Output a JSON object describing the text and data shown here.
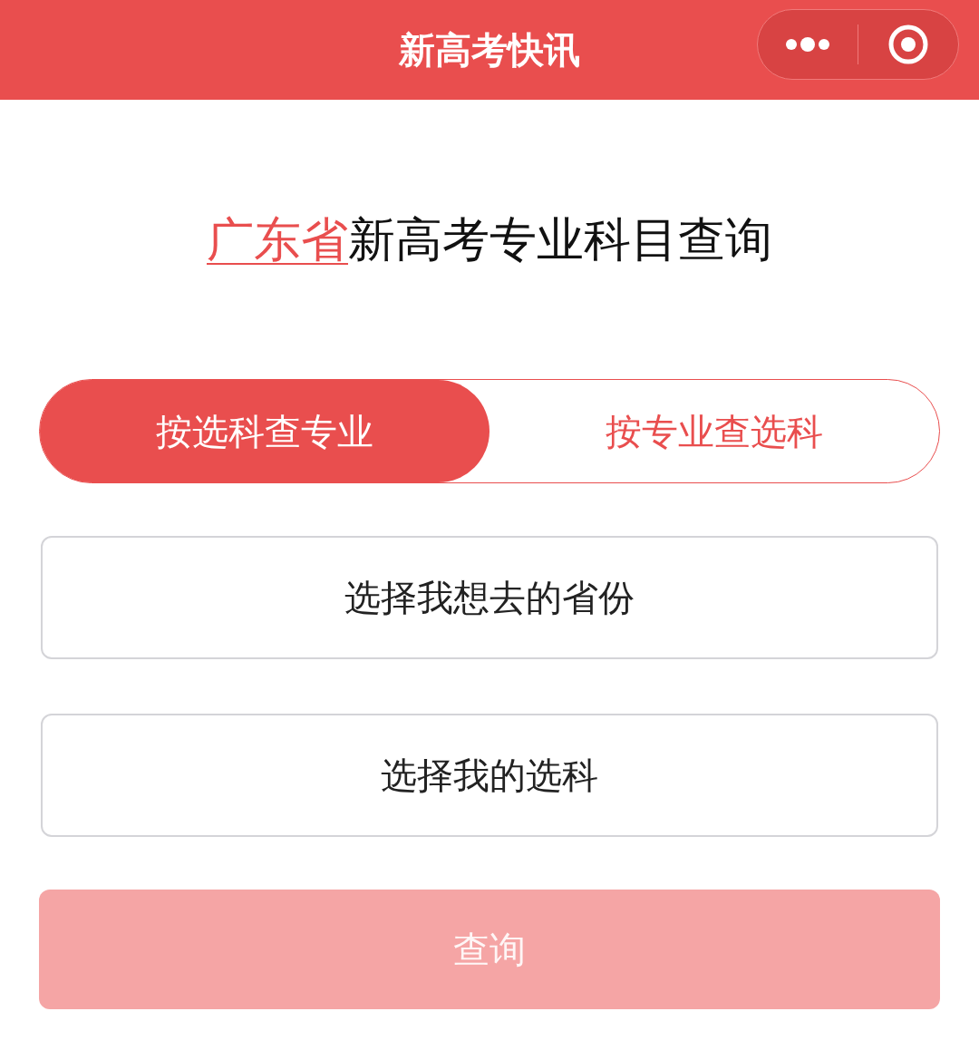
{
  "header": {
    "title": "新高考快讯"
  },
  "heading": {
    "province": "广东省",
    "text": "新高考专业科目查询"
  },
  "tabs": [
    {
      "label": "按选科查专业",
      "selected": true
    },
    {
      "label": "按专业查选科",
      "selected": false
    }
  ],
  "selectors": [
    {
      "label": "选择我想去的省份"
    },
    {
      "label": "选择我的选科"
    }
  ],
  "submit": {
    "label": "查询",
    "disabled": true
  }
}
